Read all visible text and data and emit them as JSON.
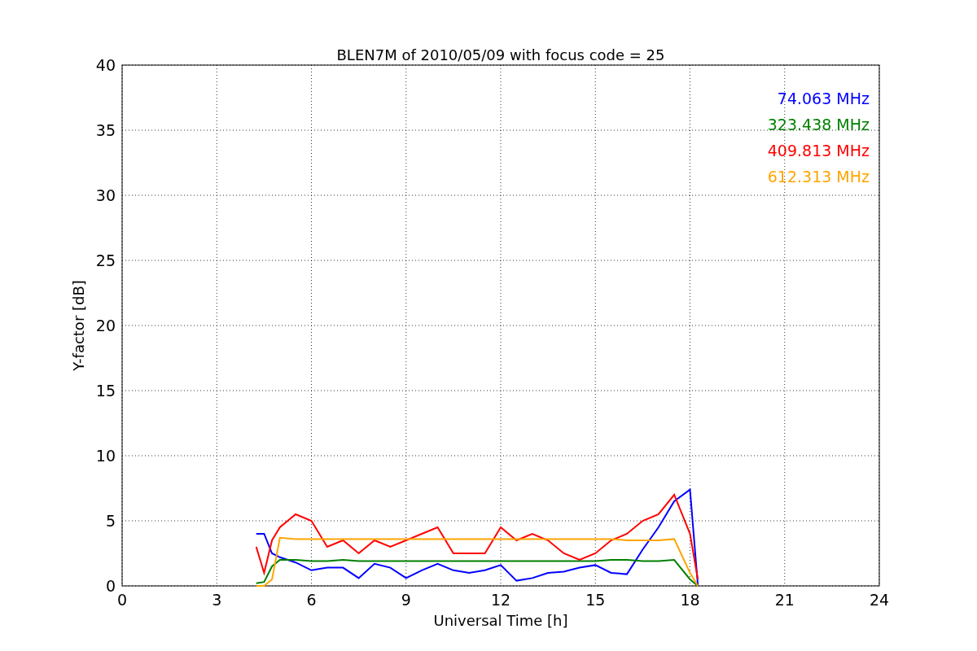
{
  "chart_data": {
    "type": "line",
    "title": "BLEN7M of 2010/05/09 with focus code = 25",
    "xlabel": "Universal Time [h]",
    "ylabel": "Y-factor [dB]",
    "x": [
      4.25,
      4.5,
      4.75,
      5,
      5.5,
      6,
      6.5,
      7,
      7.5,
      8,
      8.5,
      9,
      9.5,
      10,
      10.5,
      11,
      11.5,
      12,
      12.5,
      13,
      13.5,
      14,
      14.5,
      15,
      15.5,
      16,
      16.5,
      17,
      17.5,
      18,
      18.25
    ],
    "series": [
      {
        "name": "74.063 MHz",
        "color": "#0000ff",
        "values": [
          4.0,
          4.0,
          2.5,
          2.2,
          1.8,
          1.2,
          1.4,
          1.4,
          0.6,
          1.7,
          1.4,
          0.6,
          1.2,
          1.7,
          1.2,
          1.0,
          1.2,
          1.6,
          0.4,
          0.6,
          1.0,
          1.1,
          1.4,
          1.6,
          1.0,
          0.9,
          2.8,
          4.5,
          6.5,
          7.4,
          0.0
        ]
      },
      {
        "name": "323.438 MHz",
        "color": "#008000",
        "values": [
          0.2,
          0.3,
          1.5,
          2.0,
          2.0,
          1.9,
          1.9,
          2.0,
          1.9,
          1.9,
          1.9,
          1.9,
          1.9,
          1.9,
          1.9,
          1.9,
          1.9,
          1.9,
          1.9,
          1.9,
          1.9,
          1.9,
          1.9,
          1.9,
          2.0,
          2.0,
          1.9,
          1.9,
          2.0,
          0.5,
          0.0
        ]
      },
      {
        "name": "409.813 MHz",
        "color": "#ff0000",
        "values": [
          3.0,
          1.0,
          3.5,
          4.5,
          5.5,
          5.0,
          3.0,
          3.5,
          2.5,
          3.5,
          3.0,
          3.5,
          4.0,
          4.5,
          2.5,
          2.5,
          2.5,
          4.5,
          3.5,
          4.0,
          3.5,
          2.5,
          2.0,
          2.5,
          3.5,
          4.0,
          5.0,
          5.5,
          7.0,
          4.0,
          0.5
        ]
      },
      {
        "name": "612.313 MHz",
        "color": "#ffa500",
        "values": [
          0.0,
          0.0,
          0.5,
          3.7,
          3.6,
          3.6,
          3.6,
          3.6,
          3.6,
          3.6,
          3.6,
          3.6,
          3.6,
          3.6,
          3.6,
          3.6,
          3.6,
          3.6,
          3.6,
          3.6,
          3.6,
          3.6,
          3.6,
          3.6,
          3.6,
          3.5,
          3.5,
          3.5,
          3.6,
          1.0,
          0.0
        ]
      }
    ],
    "grid": true,
    "xlim": [
      0,
      24
    ],
    "ylim": [
      0,
      40
    ],
    "xticks": [
      0,
      3,
      6,
      9,
      12,
      15,
      18,
      21,
      24
    ],
    "yticks": [
      0,
      5,
      10,
      15,
      20,
      25,
      30,
      35,
      40
    ]
  }
}
